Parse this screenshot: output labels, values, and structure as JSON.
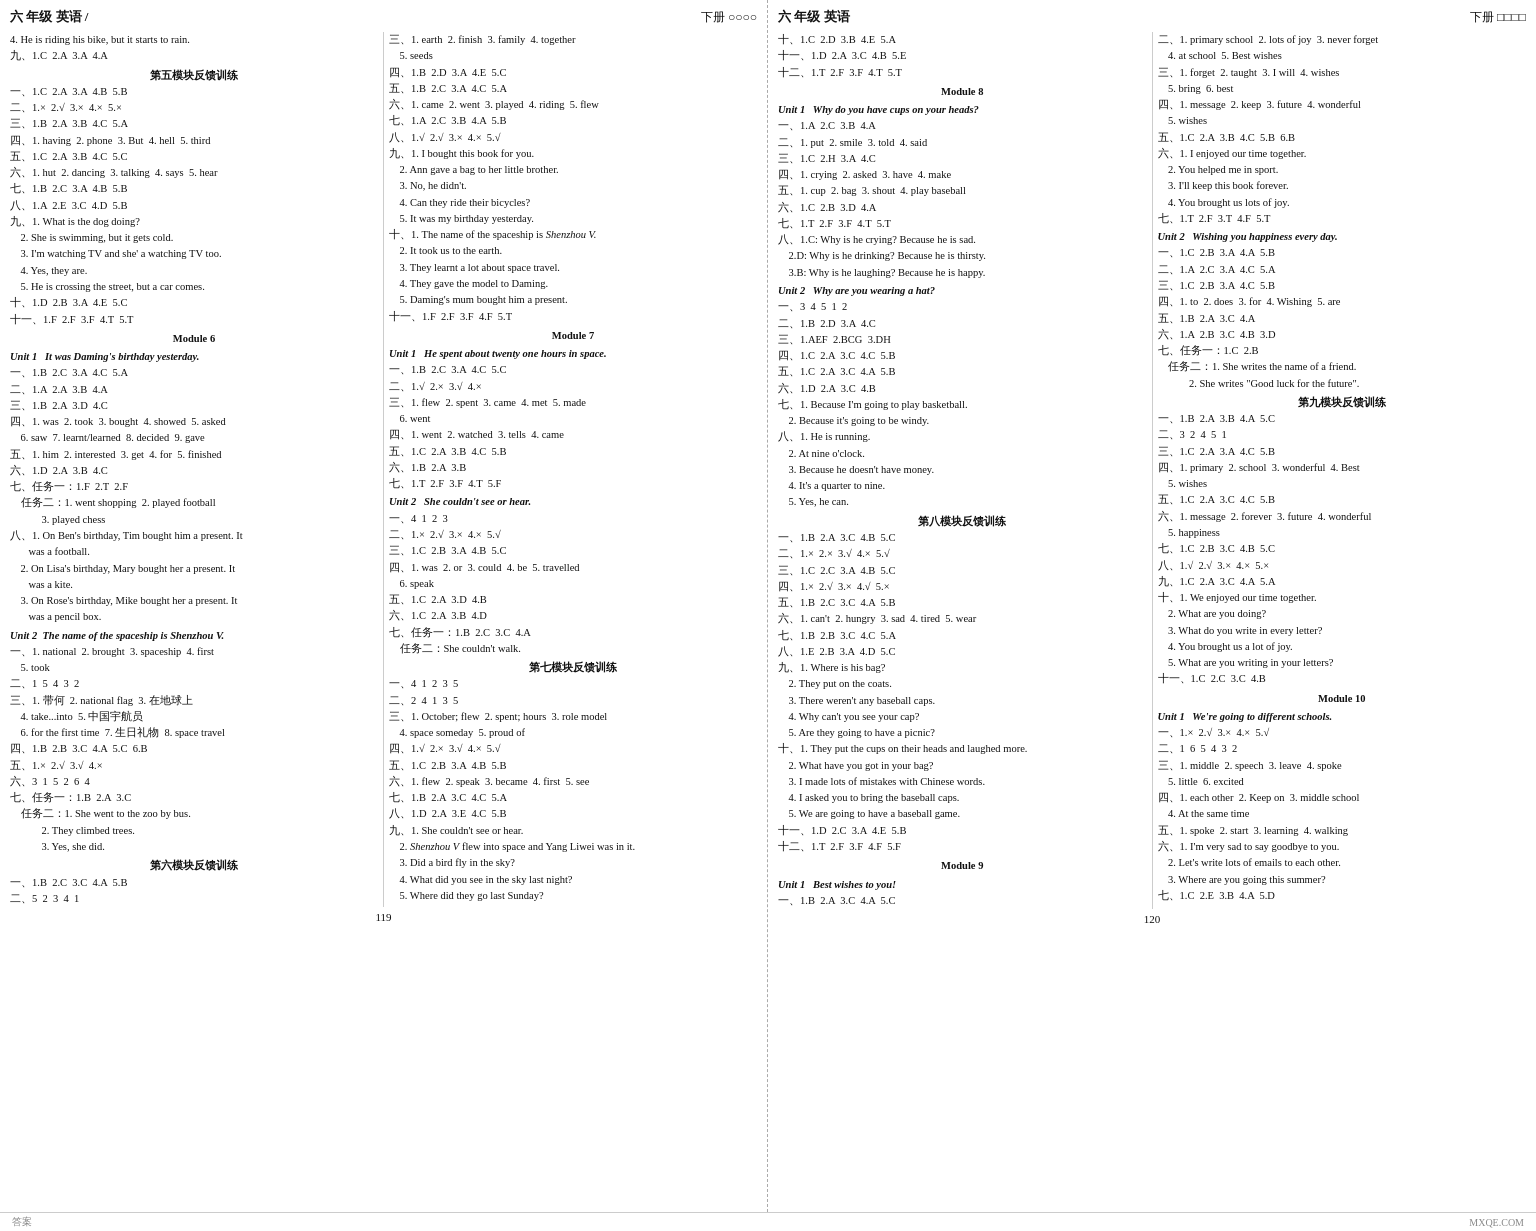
{
  "left_page": {
    "header_left": "六 年级  英语 /",
    "header_right": "下册 ○○○○",
    "page_number": "119",
    "col1": [
      "4. He is riding his bike, but it starts to rain.",
      "九、1.C  2.A  3.A  4.A",
      "第五模块反馈训练",
      "一、1.C  2.A  3.A  4.B  5.B",
      "二、1.×  2.√  3.×  4.×  5.×",
      "三、1.B  2.A  3.B  4.C  5.A",
      "四、1. having  2. phone  3. But  4. hell  5. third",
      "五、1.C  2.A  3.B  4.C  5.C",
      "六、1. hut  2. dancing  3. talking  4. says  5. hear",
      "七、1.B  2.C  3.A  4.B  5.B",
      "八、1.A  2.E  3.C  4.D  5.B",
      "九、1. What is the dog doing?",
      "    2. She is swimming, but it gets cold.",
      "    3. I'm watching TV and she' a watching TV too.",
      "    4. Yes, they are.",
      "    5. He is crossing the street, but a car comes.",
      "十、1.D  2.B  3.A  4.E  5.C",
      "十一、1.F  2.F  3.F  4.T  5.T",
      "Module 6",
      "Unit 1   It was Daming's birthday yesterday.",
      "一、1.B  2.C  3.A  4.C  5.A",
      "二、1.A  2.A  3.B  4.A",
      "三、1.B  2.A  3.D  4.C",
      "四、1. was  2. took  3. bought  4. showed  5. asked",
      "    6. saw  7. learnt/learned  8. decided  9. gave",
      "五、1. him  2. interested  3. get  4. for  5. finished",
      "六、1.D  2.A  3.B  4.C",
      "七、任务一：1.F  2.T  2.F",
      "    任务二：1. went shopping  2. played football",
      "            3. played chess",
      "八、1. On Ben's birthday, Tim bought him a present. It",
      "       was a football.",
      "    2. On Lisa's birthday, Mary bought her a present. It",
      "       was a kite.",
      "    3. On Rose's birthday, Mike bought her a present. It",
      "       was a pencil box.",
      "Unit 2  The name of the spaceship is Shenzhou V.",
      "一、1. national  2. brought  3. spaceship  4. first",
      "    5. took",
      "二、1  5  4  3  2",
      "三、1. 带何  2. national flag  3. 在地球上",
      "    4. take...into  5. 中国宇航员",
      "    6. for the first time  7. 生日礼物  8. space travel",
      "四、1.B  2.B  3.C  4.A  5.C  6.B",
      "五、1.×  2.√  3.√  4.×",
      "六、3  1  5  2  6  4",
      "七、任务一：1.B  2.A  3.C",
      "    任务二：1. She went to the zoo by bus.",
      "            2. They climbed trees.",
      "            3. Yes, she did.",
      "第六模块反馈训练",
      "一、1.B  2.C  3.C  4.A  5.B",
      "二、5  2  3  4  1"
    ],
    "col2": [
      "三、1. earth  2. finish  3. family  4. together",
      "    5. seeds",
      "四、1.B  2.D  3.A  4.E  5.C",
      "五、1.B  2.C  3.A  4.C  5.A",
      "六、1. came  2. went  3. played  4. riding  5. flew",
      "七、1.A  2.C  3.B  4.A  5.B",
      "八、1.√  2.√  3.×  4.×  5.√",
      "九、1. I bought this book for you.",
      "    2. Ann gave a bag to her little brother.",
      "    3. No, he didn't.",
      "    4. Can they ride their bicycles?",
      "    5. It was my birthday yesterday.",
      "十、1. The name of the spaceship is Shenzhou V.",
      "    2. It took us to the earth.",
      "    3. They learnt a lot about space travel.",
      "    4. They gave the model to Daming.",
      "    5. Daming's mum bought him a present.",
      "十一、1.F  2.F  3.F  4.F  5.T",
      "Module 7",
      "Unit 1   He spent about twenty one hours in space.",
      "一、1.B  2.C  3.A  4.C  5.C",
      "二、1.√  2.×  3.√  4.×",
      "三、1. flew  2. spent  3. came  4. met  5. made",
      "    6. went",
      "四、1. went  2. watched  3. tells  4. came",
      "五、1.C  2.A  3.B  4.C  5.B",
      "六、1.B  2.A  3.B",
      "七、1.T  2.F  3.F  4.T  5.F",
      "Unit 2   She couldn't see or hear.",
      "一、4  1  2  3",
      "二、1.×  2.√  3.×  4.×  5.√",
      "三、1.C  2.B  3.A  4.B  5.C",
      "四、1. was  2. or  3. could  4. be  5. travelled",
      "    6. speak",
      "五、1.C  2.A  3.D  4.B",
      "六、1.C  2.A  3.B  4.D",
      "七、任务一：1.B  2.C  3.C  4.A",
      "    任务二：She couldn't walk.",
      "第七模块反馈训练",
      "一、4  1  2  3  5",
      "二、2  4  1  3  5",
      "三、1. October; flew  2. spent; hours  3. role model",
      "    4. space someday  5. proud of",
      "四、1.√  2.×  3.√  4.×  5.√",
      "五、1.C  2.B  3.A  4.B  5.B",
      "六、1. flew  2. speak  3. became  4. first  5. see",
      "七、1.B  2.A  3.C  4.C  5.A",
      "八、1.D  2.A  3.E  4.C  5.B",
      "九、1. She couldn't see or hear.",
      "    2. Shenzhou V flew into space and Yang Liwei was in it.",
      "    3. Did a bird fly in the sky?",
      "    4. What did you see in the sky last night?",
      "    5. Where did they go last Sunday?"
    ]
  },
  "right_page": {
    "header_left": "六 年级  英语",
    "header_right": "下册 □□□□",
    "page_number": "120",
    "col1": [
      "十、1.C  2.D  3.B  4.E  5.A",
      "十一、1.D  2.A  3.C  4.B  5.E",
      "十二、1.T  2.F  3.F  4.T  5.T",
      "Module 8",
      "Unit 1   Why do you have cups on your heads?",
      "一、1.A  2.C  3.B  4.A",
      "二、1. put  2. smile  3. told  4. said",
      "三、1.C  2.H  3.A  4.C",
      "四、1. crying  2. asked  3. have  4. make",
      "五、1. cup  2. bag  3. shout  4. play baseball",
      "六、1.C  2.B  3.D  4.A",
      "七、1.T  2.F  3.F  4.T  5.T",
      "八、1.C: Why is he crying? Because he is sad.",
      "    2.D: Why is he drinking? Because he is thirsty.",
      "    3.B: Why is he laughing? Because he is happy.",
      "Unit 2   Why are you wearing a hat?",
      "一、3  4  5  1  2",
      "二、1.B  2.D  3.A  4.C",
      "三、1.AEF  2.BCG  3.DH",
      "四、1.C  2.A  3.C  4.C  5.B",
      "五、1.C  2.A  3.C  4.A  5.B",
      "六、1.D  2.A  3.C  4.B",
      "七、1. Because I'm going to play basketball.",
      "    2. Because it's going to be windy.",
      "八、1. He is running.",
      "    2. At nine o'clock.",
      "    3. Because he doesn't have money.",
      "    4. It's a quarter to nine.",
      "    5. Yes, he can.",
      "第八模块反馈训练",
      "一、1.B  2.A  3.C  4.B  5.C",
      "二、1.×  2.×  3.√  4.×  5.√",
      "三、1.C  2.C  3.A  4.B  5.C",
      "四、1.×  2.√  3.×  4.√  5.×",
      "五、1.B  2.C  3.C  4.A  5.B",
      "六、1. can't  2. hungry  3. sad  4. tired  5. wear",
      "七、1.B  2.B  3.C  4.C  5.A",
      "八、1.E  2.B  3.A  4.D  5.C",
      "九、1. Where is his bag?",
      "    2. They put on the coats.",
      "    3. There weren't any baseball caps.",
      "    4. Why can't you see your cap?",
      "    5. Are they going to have a picnic?",
      "十、1. They put the cups on their heads and laughed more.",
      "    2. What have you got in your bag?",
      "    3. I made lots of mistakes with Chinese words.",
      "    4. I asked you to bring the baseball caps.",
      "    5. We are going to have a baseball game.",
      "十一、1.D  2.C  3.A  4.E  5.B",
      "十二、1.T  2.F  3.F  4.F  5.F",
      "Module 9",
      "Unit 1   Best wishes to you!",
      "一、1.B  2.A  3.C  4.A  5.C"
    ],
    "col2": [
      "二、1. primary school  2. lots of joy  3. never forget",
      "    4. at school  5. Best wishes",
      "三、1. forget  2. taught  3. I will  4. wishes",
      "    5. bring  6. best",
      "四、1. message  2. keep  3. future  4. wonderful",
      "    5. wishes",
      "五、1.C  2.A  3.B  4.C  5.B  6.B",
      "六、1. I enjoyed our time together.",
      "    2. You helped me in sport.",
      "    3. I'll keep this book forever.",
      "    4. You brought us lots of joy.",
      "七、1.T  2.F  3.T  4.F  5.T",
      "Unit 2   Wishing you happiness every day.",
      "一、1.C  2.B  3.A  4.A  5.B",
      "二、1.A  2.C  3.A  4.C  5.A",
      "三、1.C  2.B  3.A  4.C  5.B",
      "四、1. to  2. does  3. for  4. Wishing  5. are",
      "五、1.B  2.A  3.C  4.A",
      "六、1.A  2.B  3.C  4.B  3.D",
      "七、任务一：1.C  2.B",
      "    任务二：1. She writes the name of a friend.",
      "            2. She writes \"Good luck for the future\".",
      "第九模块反馈训练",
      "一、1.B  2.A  3.B  4.A  5.C",
      "二、3  2  4  5  1",
      "三、1.C  2.A  3.A  4.C  5.B",
      "四、1. primary  2. school  3. wonderful  4. Best",
      "    5. wishes",
      "五、1.C  2.A  3.C  4.C  5.B",
      "六、1. message  2. forever  3. future  4. wonderful",
      "    5. happiness",
      "七、1.C  2.B  3.C  4.B  5.C",
      "八、1.√  2.√  3.×  4.×  5.×",
      "九、1.C  2.A  3.C  4.A  5.A",
      "十、1. We enjoyed our time together.",
      "    2. What are you doing?",
      "    3. What do you write in every letter?",
      "    4. You brought us a lot of joy.",
      "    5. What are you writing in your letters?",
      "十一、1.C  2.C  3.C  4.B",
      "Module 10",
      "Unit 1   We're going to different schools.",
      "一、1.×  2.√  3.×  4.×  5.√",
      "二、1  6  5  4  3  2",
      "三、1. middle  2. speech  3. leave  4. spoke",
      "    5. little  6. excited",
      "四、1. each other  2. Keep on  3. middle school",
      "    4. At the same time",
      "五、1. spoke  2. start  3. learning  4. walking",
      "六、1. I'm very sad to say goodbye to you.",
      "    2. Let's write lots of emails to each other.",
      "    3. Where are you going this summer?",
      "七、1.C  2.E  3.B  4.A  5.D"
    ]
  }
}
